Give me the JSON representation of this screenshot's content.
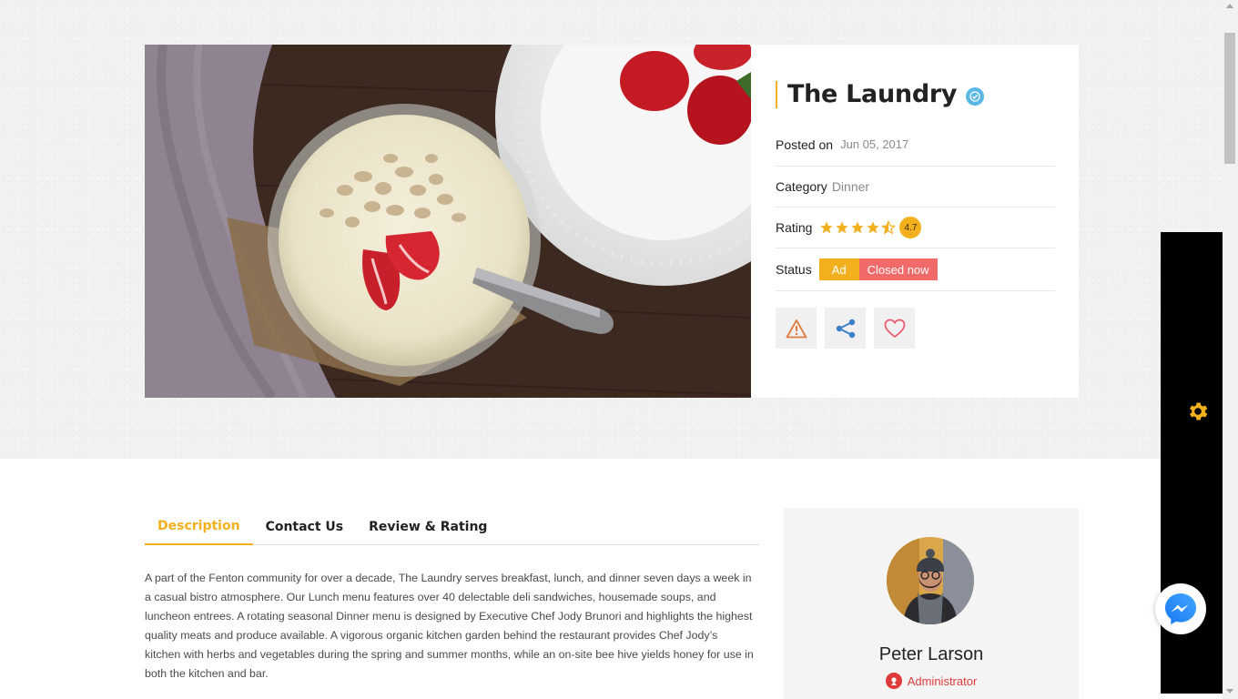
{
  "listing": {
    "title": "The Laundry",
    "posted_label": "Posted on",
    "posted_date": "Jun 05, 2017",
    "category_label": "Category",
    "category": "Dinner",
    "rating_label": "Rating",
    "rating_stars": 4.5,
    "rating_value": "4.7",
    "status_label": "Status",
    "status_ad": "Ad",
    "status_open": "Closed now",
    "accent_color": "#f2b01e",
    "closed_color": "#f06a6a"
  },
  "actions": {
    "report_icon": "warning-triangle-icon",
    "share_icon": "share-icon",
    "favorite_icon": "heart-icon"
  },
  "tabs": [
    {
      "label": "Description"
    },
    {
      "label": "Contact Us"
    },
    {
      "label": "Review & Rating"
    }
  ],
  "description": "A part of the Fenton community for over a decade, The Laundry serves breakfast, lunch, and dinner seven days a week in a casual bistro atmosphere.   Our Lunch menu features over 40 delectable deli sandwiches, housemade soups, and luncheon entrees.  A rotating seasonal Dinner menu is designed by Executive Chef Jody Brunori and highlights the highest quality meats and produce available.  A vigorous organic kitchen garden behind the restaurant provides Chef Jody’s kitchen with herbs and vegetables during the spring and summer months, while an on-site bee hive yields honey for use in both the kitchen and bar.",
  "author": {
    "name": "Peter Larson",
    "role": "Administrator"
  }
}
